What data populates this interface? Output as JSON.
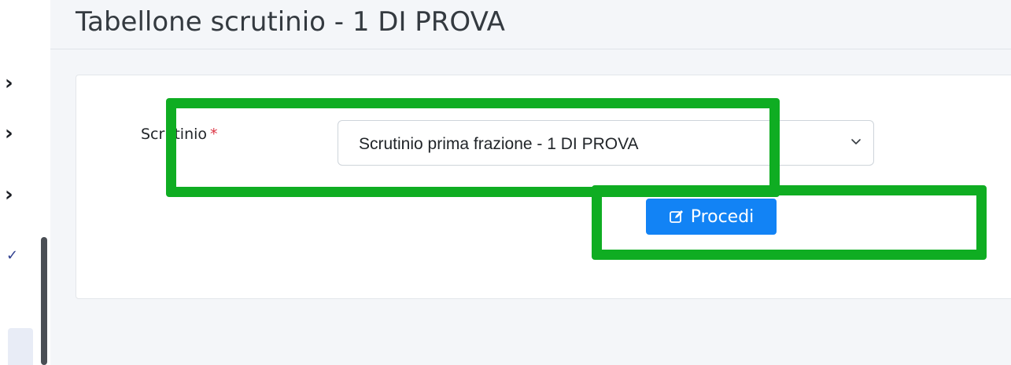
{
  "page": {
    "title": "Tabellone scrutinio - 1 DI PROVA"
  },
  "sidebar": {
    "chevron_glyph": "›",
    "check_glyph": "✓",
    "icons": [
      "chevron-right-icon",
      "chevron-right-icon",
      "chevron-right-icon",
      "check-icon"
    ]
  },
  "form": {
    "scrutinio_label": "Scrutinio",
    "required_marker": "*",
    "scrutinio_value": "Scrutinio prima frazione - 1 DI PROVA",
    "submit_label": "Procedi",
    "submit_icon": "edit-icon"
  },
  "colors": {
    "primary": "#1283f5",
    "required": "#dc3545",
    "highlight": "#0fad22"
  }
}
